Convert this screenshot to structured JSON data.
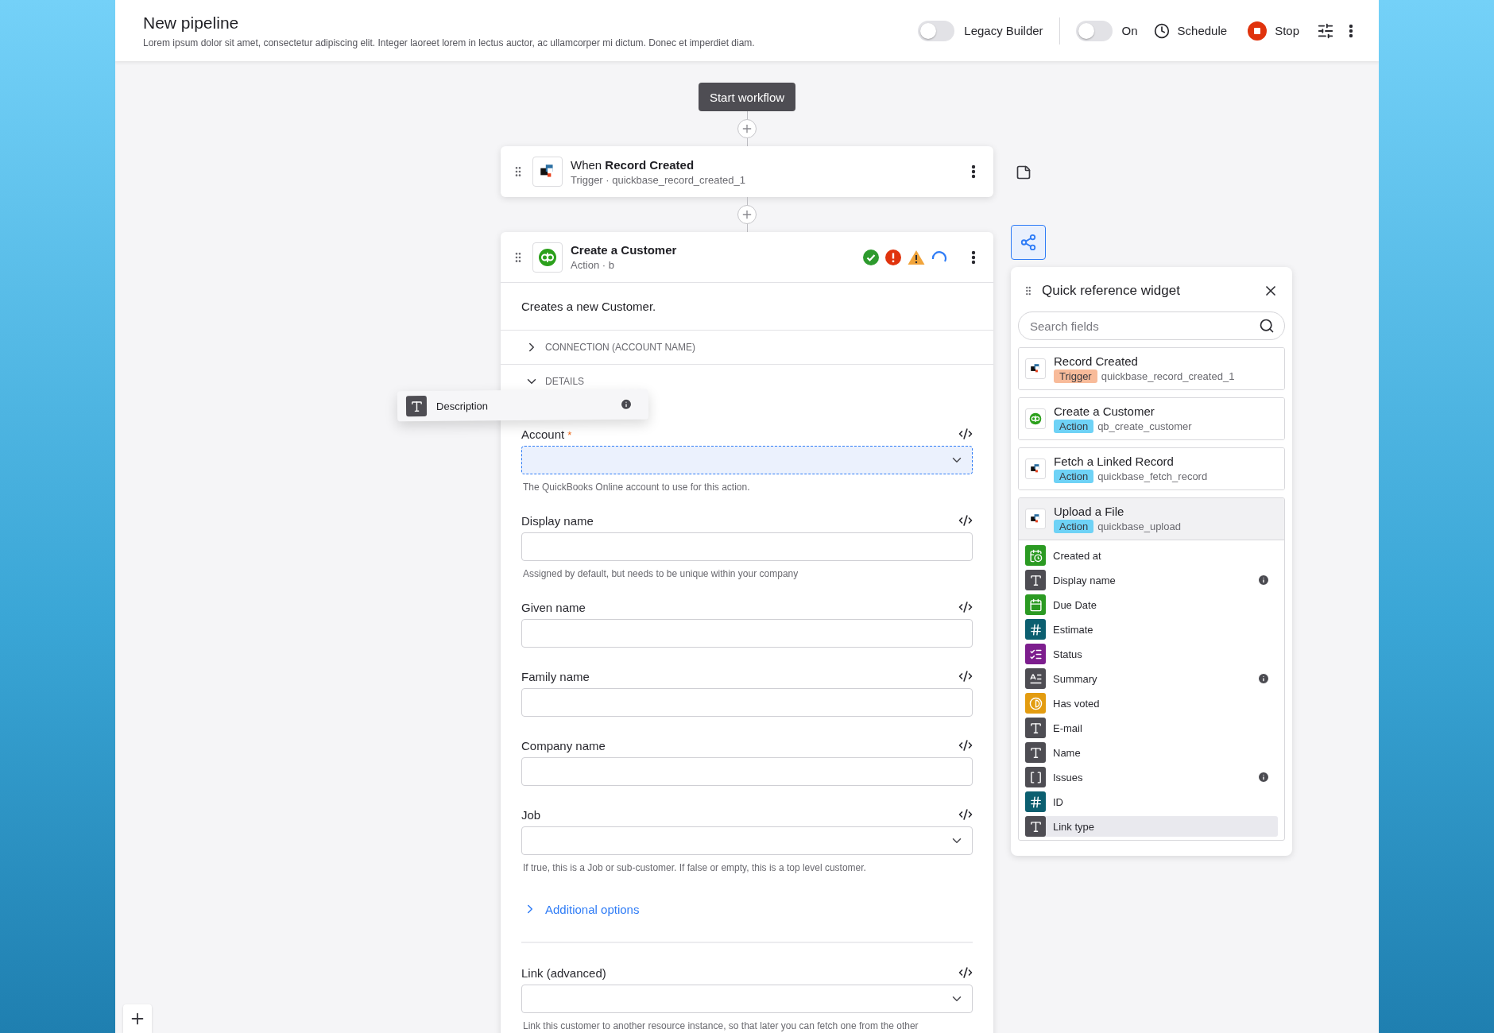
{
  "header": {
    "title": "New pipeline",
    "subtitle": "Lorem ipsum dolor sit amet, consectetur adipiscing elit. Integer laoreet lorem in lectus auctor, ac ullamcorper mi dictum. Donec et imperdiet diam.",
    "toggles": [
      {
        "label": "Legacy Builder",
        "on": false
      },
      {
        "label": "On",
        "on": false
      }
    ],
    "schedule": "Schedule",
    "stop": "Stop"
  },
  "canvas": {
    "start": "Start workflow",
    "trigger": {
      "title": "When **Record Created**",
      "subtitle": "Trigger · quickbase_record_created_1"
    },
    "action": {
      "title": "Create a Customer",
      "subtitle": "Action · b",
      "statuses": [
        {
          "kind": "success"
        },
        {
          "kind": "error"
        },
        {
          "kind": "warning"
        },
        {
          "kind": "loading"
        }
      ],
      "description": "Creates a new Customer.",
      "required_mark": "*",
      "sections": [
        {
          "label": "CONNECTION (ACCOUNT NAME)",
          "expanded": false
        },
        {
          "label": "DETAILS",
          "expanded": true
        }
      ],
      "fields": [
        {
          "label": "Account",
          "required": true,
          "kind": "select",
          "focused": true,
          "hint": "The QuickBooks Online account to use for this action."
        },
        {
          "label": "Display name",
          "required": false,
          "kind": "text",
          "focused": false,
          "hint": "Assigned by default, but needs to be unique within your company"
        },
        {
          "label": "Given name",
          "required": false,
          "kind": "text",
          "focused": false
        },
        {
          "label": "Family name",
          "required": false,
          "kind": "text",
          "focused": false
        },
        {
          "label": "Company name",
          "required": false,
          "kind": "text",
          "focused": false
        },
        {
          "label": "Job",
          "required": false,
          "kind": "select",
          "focused": false,
          "hint": "If true, this is a Job or sub-customer. If false or empty, this is a top level customer."
        }
      ],
      "additional": "Additional options",
      "advanced": [
        {
          "label": "Link (advanced)",
          "required": false,
          "kind": "select",
          "focused": false,
          "hint": "Link this customer to another resource instance, so that later you can fetch one from the other"
        }
      ]
    },
    "drag_chip": {
      "label": "Description",
      "kind": "text",
      "info": true
    }
  },
  "widget": {
    "title": "Quick reference widget",
    "search": {
      "placeholder": "Search fields"
    },
    "steps": [
      {
        "title": "Record Created",
        "kind": "trigger",
        "tag": "Trigger",
        "key": "quickbase_record_created_1",
        "logo": {
          "kind": "quickbase"
        },
        "selected": false
      },
      {
        "title": "Create a Customer",
        "kind": "action",
        "tag": "Action",
        "key": "qb_create_customer",
        "logo": {
          "kind": "qb"
        },
        "selected": false
      },
      {
        "title": "Fetch a Linked Record",
        "kind": "action",
        "tag": "Action",
        "key": "quickbase_fetch_record",
        "logo": {
          "kind": "quickbase"
        },
        "selected": false
      },
      {
        "title": "Upload a File",
        "kind": "action",
        "tag": "Action",
        "key": "quickbase_upload",
        "logo": {
          "kind": "quickbase"
        },
        "selected": true,
        "fields": [
          {
            "label": "Created at",
            "kind": "datetime",
            "info": false,
            "highlighted": false
          },
          {
            "label": "Display name",
            "kind": "text",
            "info": true,
            "highlighted": false
          },
          {
            "label": "Due Date",
            "kind": "date",
            "info": false,
            "highlighted": false
          },
          {
            "label": "Estimate",
            "kind": "number",
            "info": false,
            "highlighted": false
          },
          {
            "label": "Status",
            "kind": "choice",
            "info": false,
            "highlighted": false
          },
          {
            "label": "Summary",
            "kind": "longtext",
            "info": true,
            "highlighted": false
          },
          {
            "label": "Has voted",
            "kind": "bool",
            "info": false,
            "highlighted": false
          },
          {
            "label": "E-mail",
            "kind": "text",
            "info": false,
            "highlighted": false
          },
          {
            "label": "Name",
            "kind": "text",
            "info": false,
            "highlighted": false
          },
          {
            "label": "Issues",
            "kind": "list",
            "info": true,
            "highlighted": false
          },
          {
            "label": "ID",
            "kind": "number",
            "info": false,
            "highlighted": false
          },
          {
            "label": "Link type",
            "kind": "text",
            "info": false,
            "highlighted": true
          }
        ]
      }
    ]
  }
}
